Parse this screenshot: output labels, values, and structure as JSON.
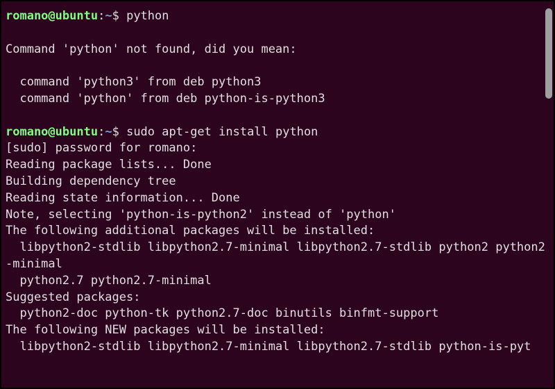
{
  "prompt": {
    "user": "romano",
    "at": "@",
    "host": "ubuntu",
    "colon": ":",
    "path": "~",
    "dollar": "$ "
  },
  "lines": [
    {
      "type": "prompt",
      "cmd": "python"
    },
    {
      "type": "blank"
    },
    {
      "type": "output",
      "text": "Command 'python' not found, did you mean:"
    },
    {
      "type": "blank"
    },
    {
      "type": "output",
      "text": "  command 'python3' from deb python3"
    },
    {
      "type": "output",
      "text": "  command 'python' from deb python-is-python3"
    },
    {
      "type": "blank"
    },
    {
      "type": "prompt",
      "cmd": "sudo apt-get install python"
    },
    {
      "type": "output",
      "text": "[sudo] password for romano:"
    },
    {
      "type": "output",
      "text": "Reading package lists... Done"
    },
    {
      "type": "output",
      "text": "Building dependency tree"
    },
    {
      "type": "output",
      "text": "Reading state information... Done"
    },
    {
      "type": "output",
      "text": "Note, selecting 'python-is-python2' instead of 'python'"
    },
    {
      "type": "output",
      "text": "The following additional packages will be installed:"
    },
    {
      "type": "output",
      "text": "  libpython2-stdlib libpython2.7-minimal libpython2.7-stdlib python2 python2-minimal"
    },
    {
      "type": "output",
      "text": "  python2.7 python2.7-minimal"
    },
    {
      "type": "output",
      "text": "Suggested packages:"
    },
    {
      "type": "output",
      "text": "  python2-doc python-tk python2.7-doc binutils binfmt-support"
    },
    {
      "type": "output",
      "text": "The following NEW packages will be installed:"
    },
    {
      "type": "output",
      "text": "  libpython2-stdlib libpython2.7-minimal libpython2.7-stdlib python-is-pyt"
    }
  ]
}
